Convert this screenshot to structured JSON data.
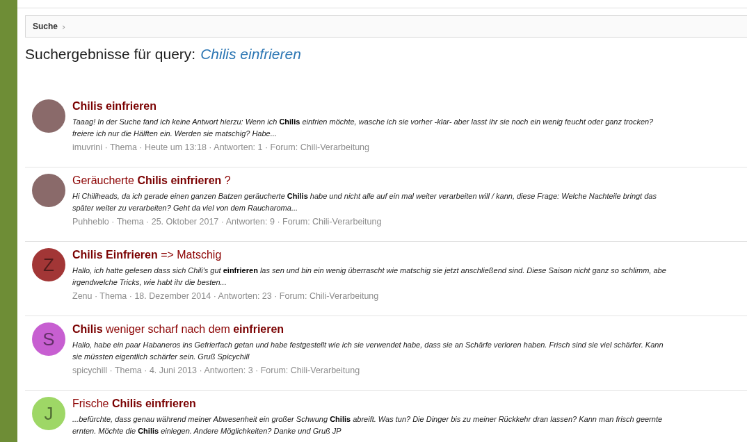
{
  "breadcrumb": {
    "label": "Suche",
    "separator": "›"
  },
  "heading": {
    "prefix": "Suchergebnisse für query:",
    "query": "Chilis einfrieren"
  },
  "results": [
    {
      "title": "**Chilis einfrieren**",
      "avatar": {
        "kind": "photo"
      },
      "snippet_lines": [
        "Taaag! In der Suche fand ich keine Antwort hierzu: Wenn ich **Chilis** einfrien möchte, wasche ich sie vorher -klar- aber lasst ihr sie noch ein wenig feucht oder ganz trocken?",
        "freiere ich nur die Hälften ein. Werden sie matschig? Habe..."
      ],
      "meta": "imuvrini · Thema · Heute um 13:18 · Antworten: 1 · Forum: Chili-Verarbeitung"
    },
    {
      "title": "Geräucherte **Chilis einfrieren** ?",
      "avatar": {
        "kind": "photo"
      },
      "snippet_lines": [
        "Hi Chiliheads, da ich gerade einen ganzen Batzen geräucherte **Chilis** habe und nicht alle auf ein mal weiter verarbeiten will / kann, diese Frage: Welche Nachteile bringt das",
        "später weiter zu verarbeiten? Geht da viel von dem Raucharoma..."
      ],
      "meta": "Puhheblo · Thema · 25. Oktober 2017 · Antworten: 9 · Forum: Chili-Verarbeitung"
    },
    {
      "title": "**Chilis Einfrieren** => Matschig",
      "avatar": {
        "kind": "letter",
        "letter": "Z",
        "color": "#a23636"
      },
      "snippet_lines": [
        "Hallo, ich hatte gelesen dass sich Chili's gut **einfrieren** las sen und bin ein wenig überrascht wie matschig sie jetzt anschließend sind. Diese Saison nicht ganz so schlimm, abe",
        "irgendwelche Tricks, wie habt ihr die besten..."
      ],
      "meta": "Zenu · Thema · 18. Dezember 2014 · Antworten: 23 · Forum: Chili-Verarbeitung"
    },
    {
      "title": "**Chilis** weniger scharf nach dem **einfrieren**",
      "avatar": {
        "kind": "letter",
        "letter": "S",
        "color": "#c75fd1"
      },
      "snippet_lines": [
        "Hallo, habe ein paar Habaneros ins Gefrierfach getan und habe festgestellt wie ich sie verwendet habe, dass sie an Schärfe verloren haben. Frisch sind sie viel schärfer. Kann",
        "sie müssten eigentlich schärfer sein. Gruß Spicychill"
      ],
      "meta": "spicychill · Thema · 4. Juni 2013 · Antworten: 3 · Forum: Chili-Verarbeitung"
    },
    {
      "title": "Frische **Chilis einfrieren**",
      "avatar": {
        "kind": "letter",
        "letter": "J",
        "color": "#9ed766"
      },
      "snippet_lines": [
        "...befürchte, dass genau während meiner Abwesenheit ein großer Schwung **Chilis** abreift. Was tun? Die Dinger bis zu meiner Rückkehr dran lassen? Kann man frisch geernte",
        "ernten. Möchte die **Chilis** einlegen. Andere Möglichkeiten? Danke und Gruß JP"
      ]
    }
  ]
}
